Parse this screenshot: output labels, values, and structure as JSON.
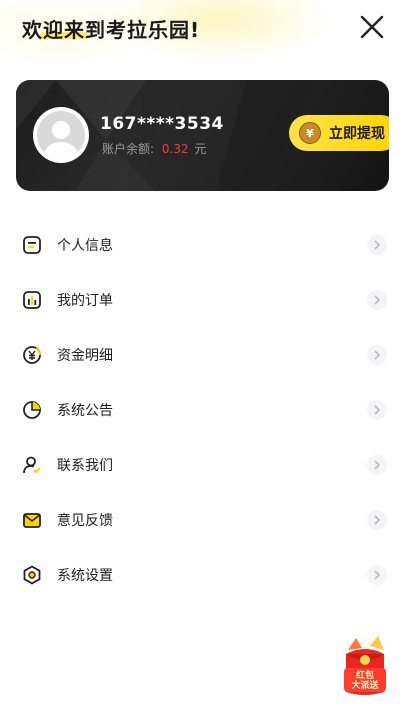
{
  "header": {
    "greeting": "欢迎来到考拉乐园!",
    "close_icon": "close-icon"
  },
  "account": {
    "phone": "167****3534",
    "balance_label": "账户余额:",
    "balance_amount": "0.32",
    "balance_unit": "元",
    "withdraw_label": "立即提现",
    "withdraw_icon_glyph": "¥"
  },
  "menu": [
    {
      "label": "个人信息",
      "icon": "profile-card-icon"
    },
    {
      "label": "我的订单",
      "icon": "orders-chart-icon"
    },
    {
      "label": "资金明细",
      "icon": "yuan-coin-icon"
    },
    {
      "label": "系统公告",
      "icon": "pie-announcement-icon"
    },
    {
      "label": "联系我们",
      "icon": "contact-user-icon"
    },
    {
      "label": "意见反馈",
      "icon": "feedback-mail-icon"
    },
    {
      "label": "系统设置",
      "icon": "settings-hexagon-icon"
    }
  ],
  "promo": {
    "line1": "红包",
    "line2": "大派送"
  },
  "colors": {
    "accent_yellow": "#ffd400",
    "balance_red": "#ff3b30",
    "card_dark": "#1c1c1c"
  }
}
